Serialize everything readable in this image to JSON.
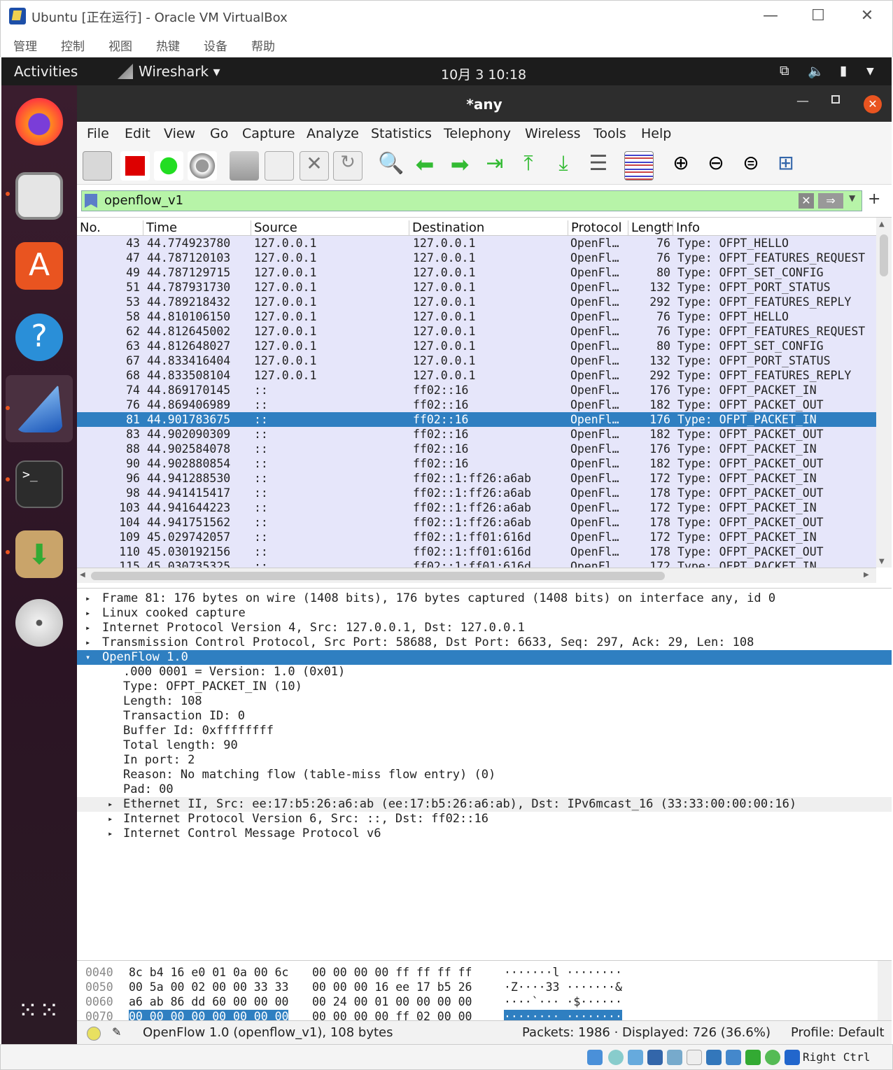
{
  "vbox": {
    "title": "Ubuntu [正在运行] - Oracle VM VirtualBox",
    "menu": [
      "管理",
      "控制",
      "视图",
      "热键",
      "设备",
      "帮助"
    ],
    "host_key": "Right Ctrl"
  },
  "topbar": {
    "activities": "Activities",
    "app": "Wireshark ▾",
    "clock": "10月 3  10:18"
  },
  "window": {
    "title": "*any"
  },
  "menu": [
    "File",
    "Edit",
    "View",
    "Go",
    "Capture",
    "Analyze",
    "Statistics",
    "Telephony",
    "Wireless",
    "Tools",
    "Help"
  ],
  "filter": {
    "value": "openflow_v1"
  },
  "columns": [
    "No.",
    "Time",
    "Source",
    "Destination",
    "Protocol",
    "Length",
    "Info"
  ],
  "packets": [
    [
      "43",
      "44.774923780",
      "127.0.0.1",
      "127.0.0.1",
      "OpenFl…",
      "76",
      "Type: OFPT_HELLO"
    ],
    [
      "47",
      "44.787120103",
      "127.0.0.1",
      "127.0.0.1",
      "OpenFl…",
      "76",
      "Type: OFPT_FEATURES_REQUEST"
    ],
    [
      "49",
      "44.787129715",
      "127.0.0.1",
      "127.0.0.1",
      "OpenFl…",
      "80",
      "Type: OFPT_SET_CONFIG"
    ],
    [
      "51",
      "44.787931730",
      "127.0.0.1",
      "127.0.0.1",
      "OpenFl…",
      "132",
      "Type: OFPT_PORT_STATUS"
    ],
    [
      "53",
      "44.789218432",
      "127.0.0.1",
      "127.0.0.1",
      "OpenFl…",
      "292",
      "Type: OFPT_FEATURES_REPLY"
    ],
    [
      "58",
      "44.810106150",
      "127.0.0.1",
      "127.0.0.1",
      "OpenFl…",
      "76",
      "Type: OFPT_HELLO"
    ],
    [
      "62",
      "44.812645002",
      "127.0.0.1",
      "127.0.0.1",
      "OpenFl…",
      "76",
      "Type: OFPT_FEATURES_REQUEST"
    ],
    [
      "63",
      "44.812648027",
      "127.0.0.1",
      "127.0.0.1",
      "OpenFl…",
      "80",
      "Type: OFPT_SET_CONFIG"
    ],
    [
      "67",
      "44.833416404",
      "127.0.0.1",
      "127.0.0.1",
      "OpenFl…",
      "132",
      "Type: OFPT_PORT_STATUS"
    ],
    [
      "68",
      "44.833508104",
      "127.0.0.1",
      "127.0.0.1",
      "OpenFl…",
      "292",
      "Type: OFPT_FEATURES_REPLY"
    ],
    [
      "74",
      "44.869170145",
      "::",
      "ff02::16",
      "OpenFl…",
      "176",
      "Type: OFPT_PACKET_IN"
    ],
    [
      "76",
      "44.869406989",
      "::",
      "ff02::16",
      "OpenFl…",
      "182",
      "Type: OFPT_PACKET_OUT"
    ],
    [
      "81",
      "44.901783675",
      "::",
      "ff02::16",
      "OpenFl…",
      "176",
      "Type: OFPT_PACKET_IN"
    ],
    [
      "83",
      "44.902090309",
      "::",
      "ff02::16",
      "OpenFl…",
      "182",
      "Type: OFPT_PACKET_OUT"
    ],
    [
      "88",
      "44.902584078",
      "::",
      "ff02::16",
      "OpenFl…",
      "176",
      "Type: OFPT_PACKET_IN"
    ],
    [
      "90",
      "44.902880854",
      "::",
      "ff02::16",
      "OpenFl…",
      "182",
      "Type: OFPT_PACKET_OUT"
    ],
    [
      "96",
      "44.941288530",
      "::",
      "ff02::1:ff26:a6ab",
      "OpenFl…",
      "172",
      "Type: OFPT_PACKET_IN"
    ],
    [
      "98",
      "44.941415417",
      "::",
      "ff02::1:ff26:a6ab",
      "OpenFl…",
      "178",
      "Type: OFPT_PACKET_OUT"
    ],
    [
      "103",
      "44.941644223",
      "::",
      "ff02::1:ff26:a6ab",
      "OpenFl…",
      "172",
      "Type: OFPT_PACKET_IN"
    ],
    [
      "104",
      "44.941751562",
      "::",
      "ff02::1:ff26:a6ab",
      "OpenFl…",
      "178",
      "Type: OFPT_PACKET_OUT"
    ],
    [
      "109",
      "45.029742057",
      "::",
      "ff02::1:ff01:616d",
      "OpenFl…",
      "172",
      "Type: OFPT_PACKET_IN"
    ],
    [
      "110",
      "45.030192156",
      "::",
      "ff02::1:ff01:616d",
      "OpenFl…",
      "178",
      "Type: OFPT_PACKET_OUT"
    ],
    [
      "115",
      "45.030735325",
      "::",
      "ff02::1:ff01:616d",
      "OpenFl…",
      "172",
      "Type: OFPT_PACKET_IN"
    ]
  ],
  "selected_row": "81",
  "details": [
    {
      "text": "Frame 81: 176 bytes on wire (1408 bits), 176 bytes captured (1408 bits) on interface any, id 0",
      "lvl": 0,
      "exp": "▸"
    },
    {
      "text": "Linux cooked capture",
      "lvl": 0,
      "exp": "▸"
    },
    {
      "text": "Internet Protocol Version 4, Src: 127.0.0.1, Dst: 127.0.0.1",
      "lvl": 0,
      "exp": "▸"
    },
    {
      "text": "Transmission Control Protocol, Src Port: 58688, Dst Port: 6633, Seq: 297, Ack: 29, Len: 108",
      "lvl": 0,
      "exp": "▸"
    },
    {
      "text": "OpenFlow 1.0",
      "lvl": 0,
      "exp": "▾",
      "sel": true
    },
    {
      "text": ".000 0001 = Version: 1.0 (0x01)",
      "lvl": 1,
      "exp": ""
    },
    {
      "text": "Type: OFPT_PACKET_IN (10)",
      "lvl": 1,
      "exp": ""
    },
    {
      "text": "Length: 108",
      "lvl": 1,
      "exp": ""
    },
    {
      "text": "Transaction ID: 0",
      "lvl": 1,
      "exp": ""
    },
    {
      "text": "Buffer Id: 0xffffffff",
      "lvl": 1,
      "exp": ""
    },
    {
      "text": "Total length: 90",
      "lvl": 1,
      "exp": ""
    },
    {
      "text": "In port: 2",
      "lvl": 1,
      "exp": ""
    },
    {
      "text": "Reason: No matching flow (table-miss flow entry) (0)",
      "lvl": 1,
      "exp": ""
    },
    {
      "text": "Pad: 00",
      "lvl": 1,
      "exp": ""
    },
    {
      "text": "Ethernet II, Src: ee:17:b5:26:a6:ab (ee:17:b5:26:a6:ab), Dst: IPv6mcast_16 (33:33:00:00:00:16)",
      "lvl": 1,
      "exp": "▸",
      "gray": true
    },
    {
      "text": "Internet Protocol Version 6, Src: ::, Dst: ff02::16",
      "lvl": 1,
      "exp": "▸"
    },
    {
      "text": "Internet Control Message Protocol v6",
      "lvl": 1,
      "exp": "▸"
    }
  ],
  "hex": [
    {
      "off": "0040",
      "a": "8c b4 16 e0 01 0a 00 6c",
      "b": "00 00 00 00 ff ff ff ff",
      "asc": "·······l ········"
    },
    {
      "off": "0050",
      "a": "00 5a 00 02 00 00 33 33",
      "b": "00 00 00 16 ee 17 b5 26",
      "asc": "·Z····33 ·······&"
    },
    {
      "off": "0060",
      "a": "a6 ab 86 dd 60 00 00 00",
      "b": "00 24 00 01 00 00 00 00",
      "asc": "····`··· ·$······"
    },
    {
      "off": "0070",
      "a": "00 00 00 00 00 00 00 00",
      "b": "00 00 00 00 ff 02 00 00",
      "asc": "········ ········"
    }
  ],
  "status": {
    "left": "OpenFlow 1.0 (openflow_v1), 108 bytes",
    "packets": "Packets: 1986 · Displayed: 726 (36.6%)",
    "profile": "Profile: Default"
  },
  "colors": {
    "selected": "#2f7fc1",
    "row_bg": "#e6e6fa",
    "filter_ok": "#b7f4a8"
  }
}
